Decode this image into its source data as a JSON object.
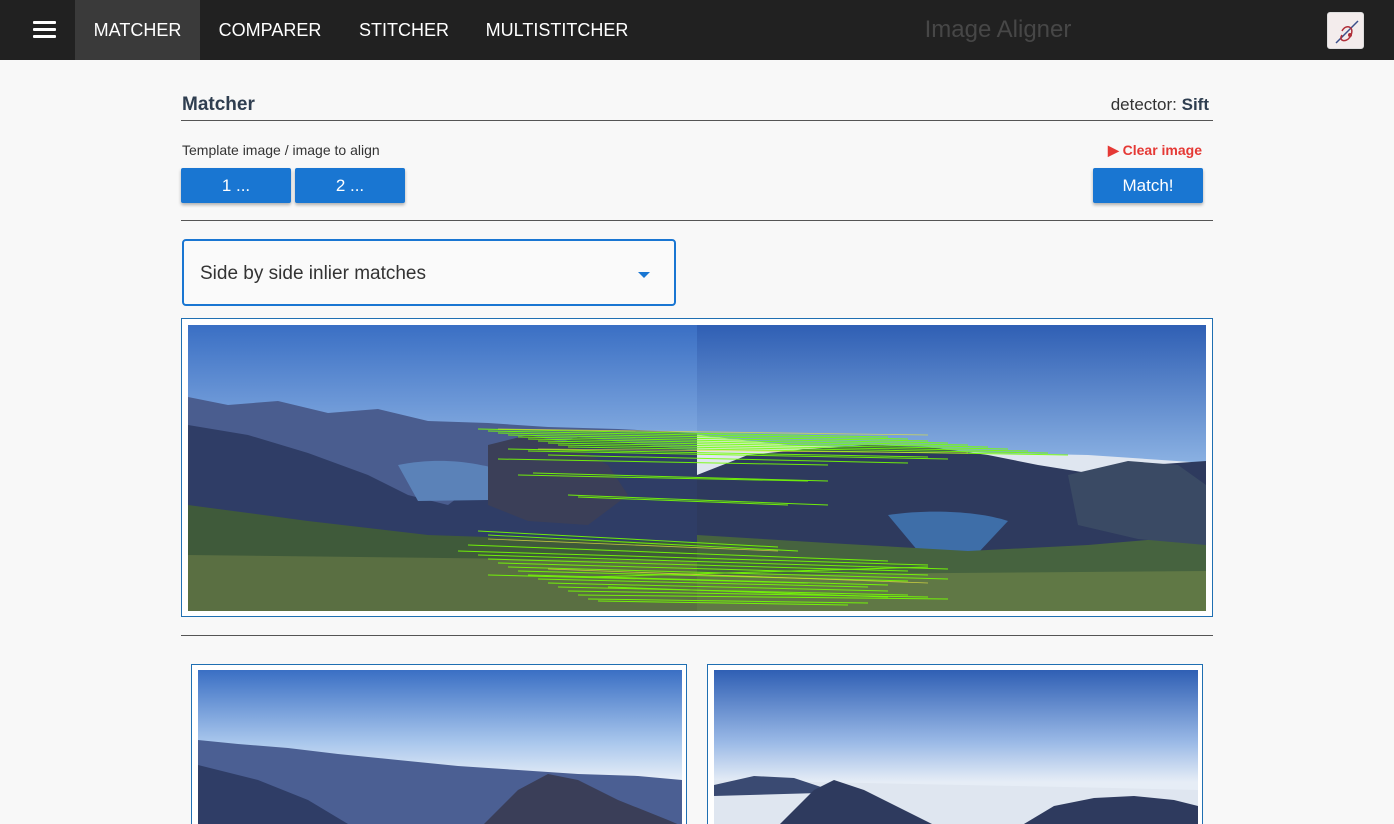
{
  "nav": {
    "menu_icon": "menu-icon",
    "tabs": [
      {
        "label": "MATCHER",
        "active": true
      },
      {
        "label": "COMPARER",
        "active": false
      },
      {
        "label": "STITCHER",
        "active": false
      },
      {
        "label": "MULTISTITCHER",
        "active": false
      }
    ],
    "app_title": "Image Aligner",
    "avatar_icon": "logo-icon"
  },
  "section": {
    "title": "Matcher",
    "detector_label": "detector:",
    "detector_value": "Sift"
  },
  "controls": {
    "hint": "Template image / image to align",
    "clear_label": "▶ Clear image",
    "clear_color": "#e53935",
    "image1_button": "1 ...",
    "image2_button": "2 ...",
    "match_button": "Match!",
    "accent_color": "#1976d2"
  },
  "view_select": {
    "selected": "Side by side inlier matches"
  },
  "match_line_color": "#76ff03"
}
